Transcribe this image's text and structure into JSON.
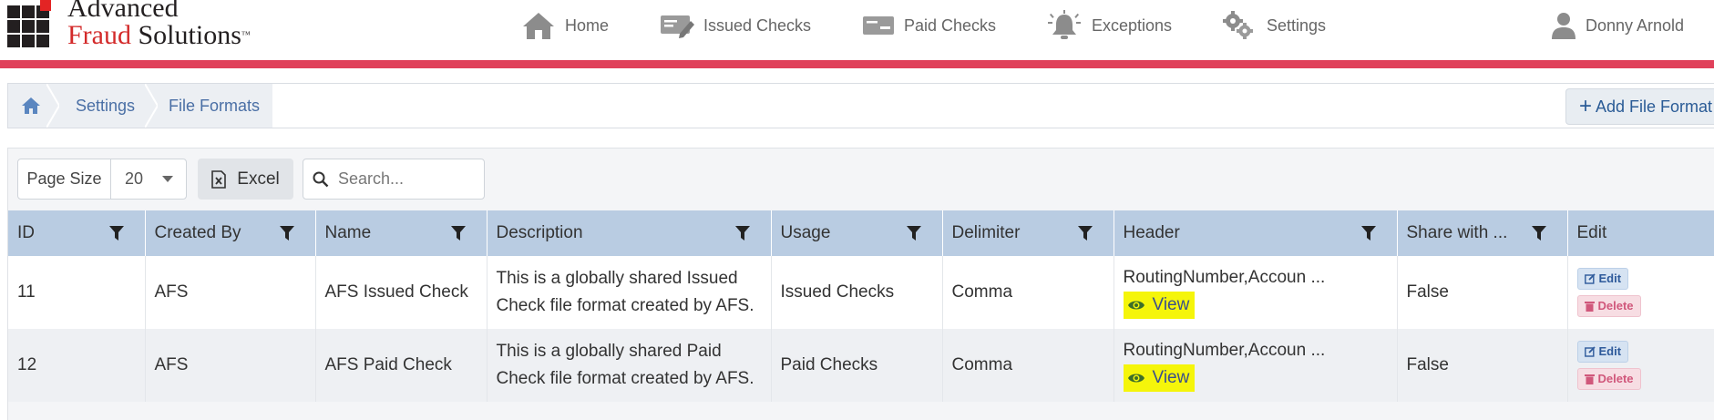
{
  "brand": {
    "line1": "Advanced",
    "line2a": "Fraud",
    "line2b": "Solutions",
    "tm": "™"
  },
  "nav": {
    "home": "Home",
    "issued_checks": "Issued Checks",
    "paid_checks": "Paid Checks",
    "exceptions": "Exceptions",
    "settings": "Settings",
    "user": "Donny Arnold"
  },
  "breadcrumb": {
    "settings": "Settings",
    "file_formats": "File Formats"
  },
  "add_button": {
    "label": "Add File Format"
  },
  "toolbar": {
    "page_size_label": "Page Size",
    "page_size_value": "20",
    "excel_label": "Excel",
    "search_placeholder": "Search..."
  },
  "table": {
    "columns": [
      "ID",
      "Created By",
      "Name",
      "Description",
      "Usage",
      "Delimiter",
      "Header",
      "Share with ...",
      "Edit"
    ],
    "rows": [
      {
        "id": "11",
        "created_by": "AFS",
        "name": "AFS Issued Check",
        "description_l1": "This is a globally shared Issued",
        "description_l2": "Check file format created by AFS.",
        "usage": "Issued Checks",
        "delimiter": "Comma",
        "header": "RoutingNumber,Accoun ...",
        "view": "View",
        "share": "False",
        "edit": "Edit",
        "delete": "Delete"
      },
      {
        "id": "12",
        "created_by": "AFS",
        "name": "AFS Paid Check",
        "description_l1": "This is a globally shared Paid",
        "description_l2": "Check file format created by AFS.",
        "usage": "Paid Checks",
        "delimiter": "Comma",
        "header": "RoutingNumber,Accoun ...",
        "view": "View",
        "share": "False",
        "edit": "Edit",
        "delete": "Delete"
      }
    ]
  },
  "colors": {
    "accent_red": "#e0405a",
    "header_blue": "#b9cce2",
    "link_blue": "#4a6fa5",
    "highlight_yellow": "#f5f50a"
  }
}
